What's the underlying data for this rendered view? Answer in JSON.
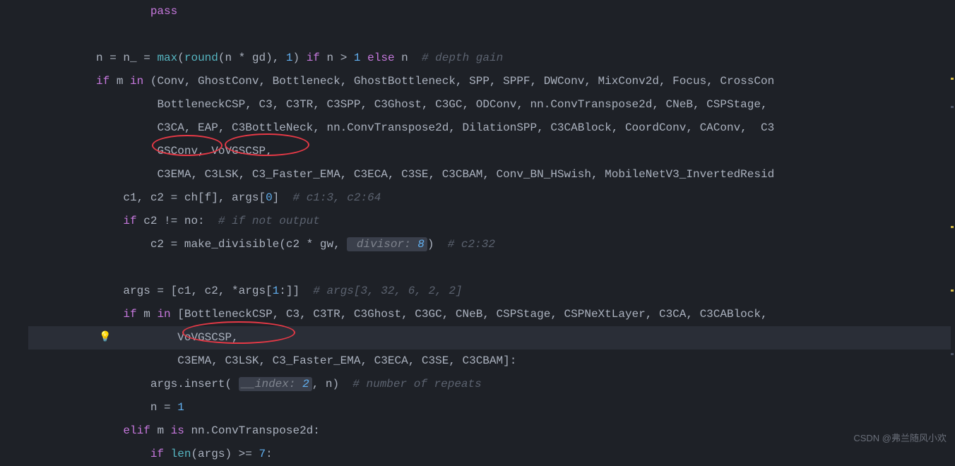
{
  "code": {
    "l1_pass": "pass",
    "l3_n": "n ",
    "l3_eq": "= ",
    "l3_n2": "n_ ",
    "l3_eq2": "= ",
    "l3_max": "max",
    "l3_open": "(",
    "l3_round": "round",
    "l3_args": "(n * gd), ",
    "l3_one": "1",
    "l3_close": ") ",
    "l3_if": "if ",
    "l3_cond": "n > ",
    "l3_one2": "1",
    "l3_else": " else ",
    "l3_n3": "n  ",
    "l3_cmt": "# depth gain",
    "l4_if": "if ",
    "l4_m": "m ",
    "l4_in": "in ",
    "l4_tuple": "(Conv, GhostConv, Bottleneck, GhostBottleneck, SPP, SPPF, DWConv, MixConv2d, Focus, CrossCon",
    "l5": "BottleneckCSP, C3, C3TR, C3SPP, C3Ghost, C3GC, ODConv, nn.ConvTranspose2d, CNeB, CSPStage, ",
    "l6": "C3CA, EAP, C3BottleNeck, nn.ConvTranspose2d, DilationSPP, C3CABlock, CoordConv, CAConv,  C3",
    "l7": "GSConv, VoVGSCSP,",
    "l8": "C3EMA, C3LSK, C3_Faster_EMA, C3ECA, C3SE, C3CBAM, Conv_BN_HSwish, MobileNetV3_InvertedResid",
    "l9_a": "c1, c2 = ch[f], args[",
    "l9_zero": "0",
    "l9_b": "]  ",
    "l9_cmt": "# c1:3, c2:64",
    "l10_if": "if ",
    "l10_cond": "c2 != no:  ",
    "l10_cmt": "# if not output",
    "l11_a": "c2 = make_divisible(c2 * gw, ",
    "l11_hint": " divisor: ",
    "l11_val": "8",
    "l11_b": ")  ",
    "l11_cmt": "# c2:32",
    "l13_a": "args = [c1, c2, *args[",
    "l13_one": "1",
    "l13_b": ":]]  ",
    "l13_cmt": "# args[3, 32, 6, 2, 2]",
    "l14_if": "if ",
    "l14_m": "m ",
    "l14_in": "in ",
    "l14_list": "[BottleneckCSP, C3, C3TR, C3Ghost, C3GC, CNeB, CSPStage, CSPNeXtLayer, C3CA, C3CABlock, ",
    "l15": "VoVGSCSP,",
    "l16": "C3EMA, C3LSK, C3_Faster_EMA, C3ECA, C3SE, C3CBAM]:",
    "l17_a": "args.insert( ",
    "l17_hint": "__index: ",
    "l17_val": "2",
    "l17_b": ", n)  ",
    "l17_cmt": "# number of repeats",
    "l18_a": "n = ",
    "l18_one": "1",
    "l19_elif": "elif ",
    "l19_cond": "m ",
    "l19_is": "is ",
    "l19_rest": "nn.ConvTranspose2d:",
    "l20_if": "if ",
    "l20_len": "len",
    "l20_a": "(args) >= ",
    "l20_seven": "7",
    "l20_b": ":"
  },
  "watermark": "CSDN @弗兰随风小欢"
}
